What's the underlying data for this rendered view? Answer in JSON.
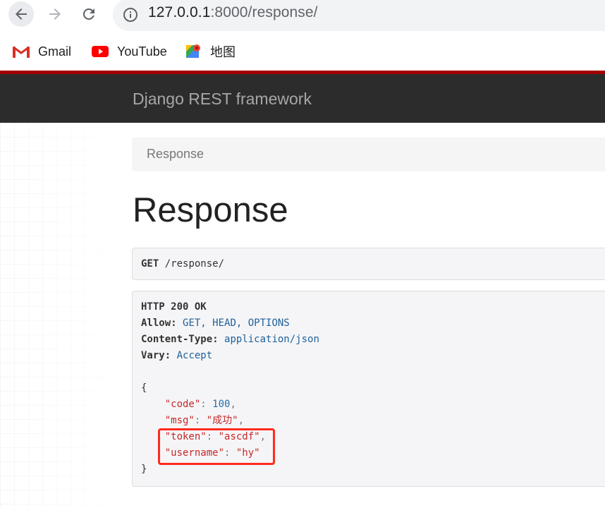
{
  "browser": {
    "url_host": "127.0.0.1",
    "url_rest": ":8000/response/",
    "bookmarks": [
      {
        "label": "Gmail",
        "icon": "gmail-icon"
      },
      {
        "label": "YouTube",
        "icon": "youtube-icon"
      },
      {
        "label": "地图",
        "icon": "maps-icon"
      }
    ]
  },
  "navbar": {
    "brand": "Django REST framework",
    "accent": "#a30000",
    "background": "#2c2c2c"
  },
  "breadcrumb": {
    "item": "Response"
  },
  "page": {
    "title": "Response"
  },
  "request": {
    "method": "GET",
    "path": "/response/"
  },
  "response": {
    "status_line": "HTTP 200 OK",
    "headers": [
      {
        "name": "Allow:",
        "value": "GET, HEAD, OPTIONS"
      },
      {
        "name": "Content-Type:",
        "value": "application/json"
      },
      {
        "name": "Vary:",
        "value": "Accept"
      }
    ],
    "body": {
      "open": "{",
      "close": "}",
      "fields": [
        {
          "key": "\"code\"",
          "value": "100",
          "trail": ","
        },
        {
          "key": "\"msg\"",
          "value": "\"成功\"",
          "trail": ","
        },
        {
          "key": "\"token\"",
          "value": "\"ascdf\"",
          "trail": ","
        },
        {
          "key": "\"username\"",
          "value": "\"hy\"",
          "trail": ""
        }
      ]
    },
    "highlight_color": "#ff2a1f"
  }
}
